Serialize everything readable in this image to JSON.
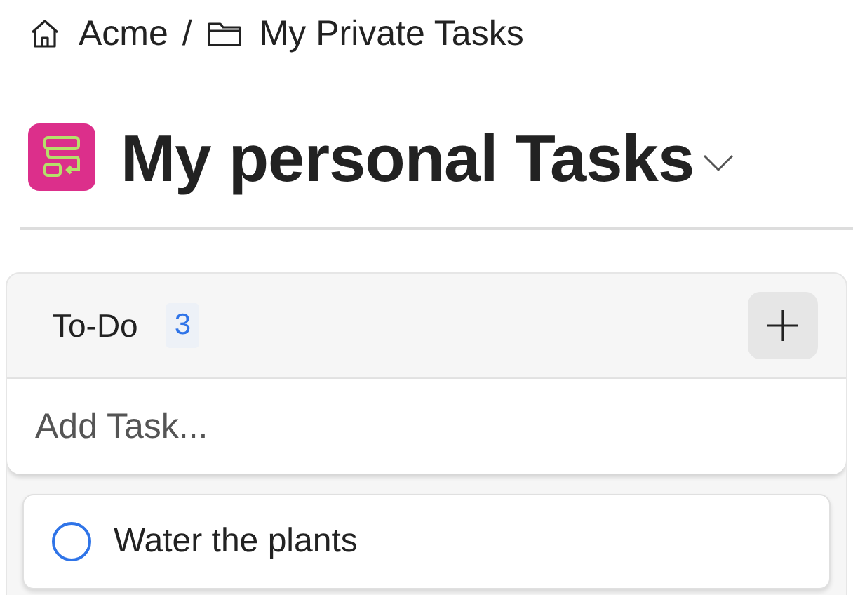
{
  "breadcrumb": [
    {
      "kind": "home",
      "label": "Acme"
    },
    {
      "kind": "folder",
      "label": "My Private Tasks"
    }
  ],
  "breadcrumb_separator": "/",
  "project": {
    "title": "My personal Tasks"
  },
  "column": {
    "title": "To-Do",
    "count": "3",
    "add_task": {
      "placeholder": "Add Task..."
    },
    "tasks": [
      {
        "title": "Water the plants",
        "checked": false
      }
    ]
  }
}
